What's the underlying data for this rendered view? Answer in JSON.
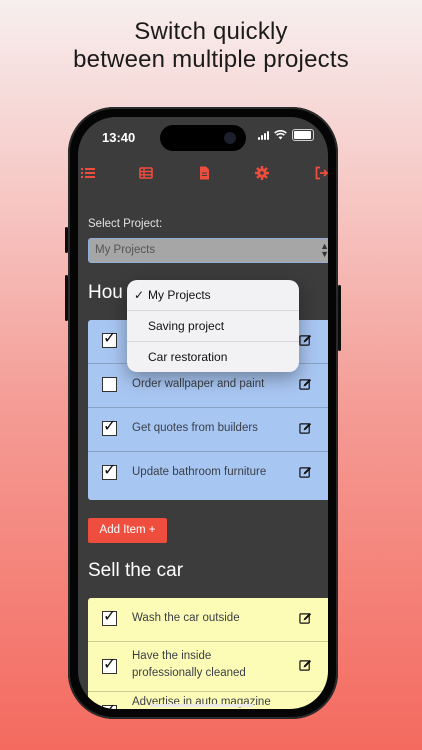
{
  "headline": {
    "line1": "Switch quickly",
    "line2": "between multiple projects"
  },
  "status_bar": {
    "time": "13:40"
  },
  "toolbar": {
    "icons": [
      "list-icon",
      "table-icon",
      "document-icon",
      "settings-gear-icon",
      "logout-icon"
    ],
    "accent_color": "#ef4d3d"
  },
  "project_select": {
    "label": "Select Project:",
    "value": "My Projects"
  },
  "dropdown": {
    "options": [
      {
        "label": "My Projects",
        "checked": true,
        "check_mark": "✓"
      },
      {
        "label": "Saving project",
        "checked": false
      },
      {
        "label": "Car restoration",
        "checked": false
      }
    ]
  },
  "section1": {
    "title_partial": "Hou",
    "color": "#a8c6f2",
    "items": [
      {
        "text": "",
        "checked": true
      },
      {
        "text": "Order wallpaper and paint",
        "checked": false
      },
      {
        "text": "Get quotes from builders",
        "checked": true
      },
      {
        "text": "Update bathroom furniture",
        "checked": true
      }
    ]
  },
  "add_item_button": "Add Item +",
  "section2": {
    "title": "Sell the car",
    "color": "#fcfcb6",
    "items": [
      {
        "text": "Wash the car outside",
        "checked": true
      },
      {
        "text": "Have the inside professionally cleaned",
        "checked": true
      },
      {
        "text": "Advertise in auto magazine",
        "checked": true
      }
    ]
  }
}
